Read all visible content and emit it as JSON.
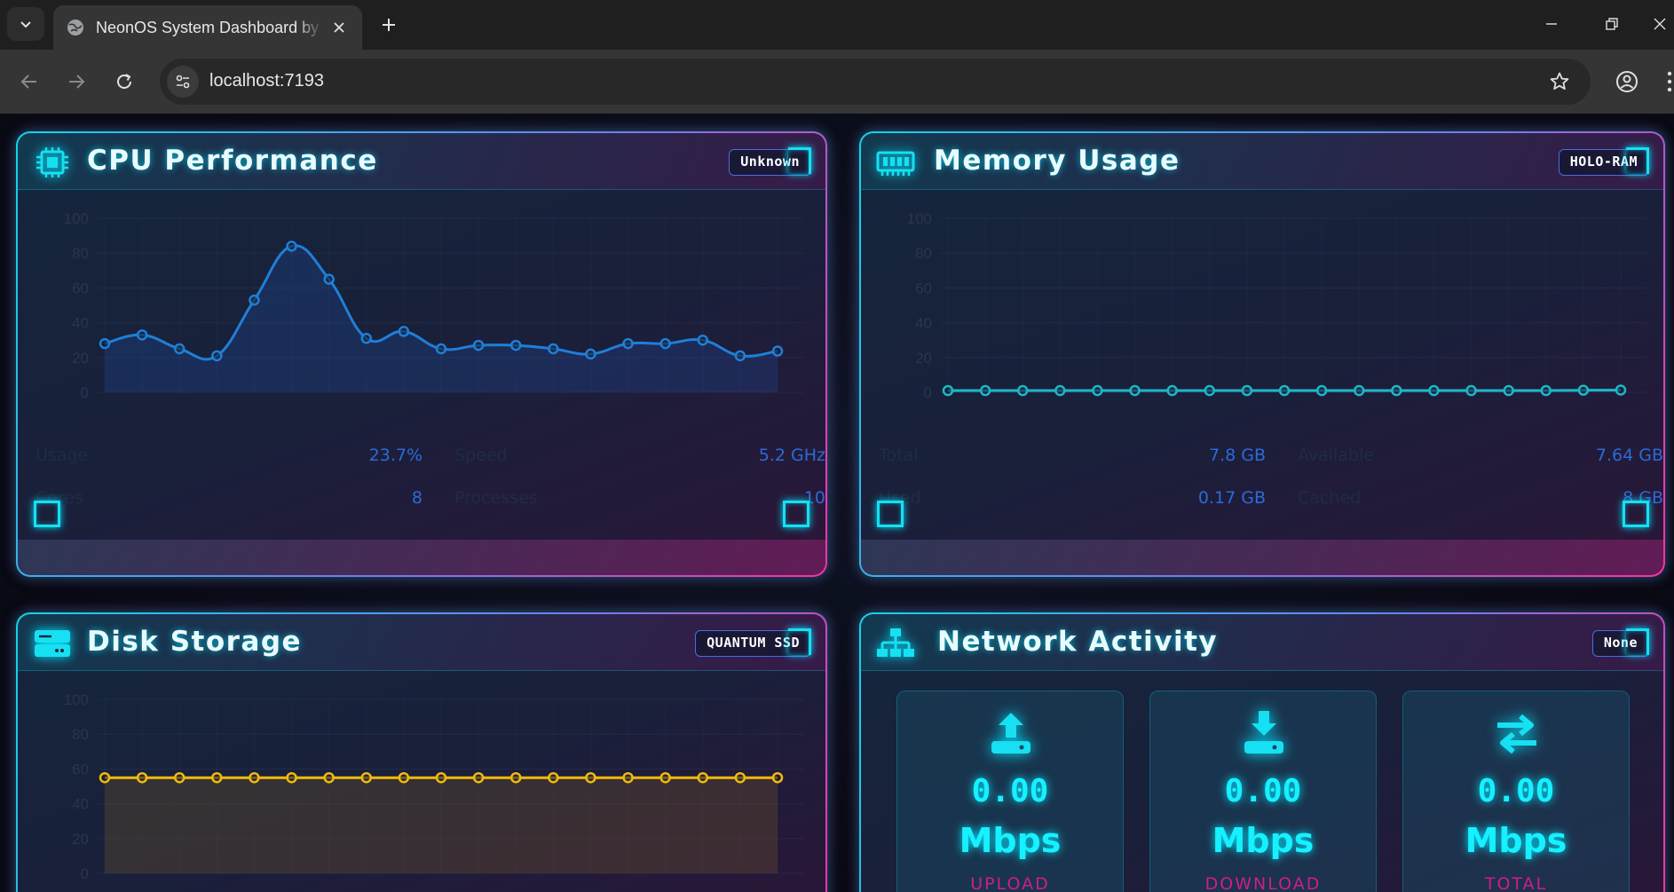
{
  "browser": {
    "tab_title": "NeonOS System Dashboard by ...",
    "url": "localhost:7193"
  },
  "colors": {
    "cyan_accent": "#16e0f2",
    "magenta_accent": "#ff2fa6",
    "cpu_line": "#1f7fd8",
    "memory_line": "#1fb6c8",
    "disk_line": "#f2b90c"
  },
  "cpu": {
    "title": "CPU Performance",
    "badge": "Unknown",
    "icon": "cpu-chip-icon",
    "stats": [
      {
        "label": "Usage",
        "value": "23.7%"
      },
      {
        "label": "Speed",
        "value": "5.2 GHz"
      },
      {
        "label": "Cores",
        "value": "8"
      },
      {
        "label": "Processes",
        "value": "10"
      }
    ]
  },
  "memory": {
    "title": "Memory Usage",
    "badge": "HOLO-RAM",
    "icon": "memory-module-icon",
    "stats": [
      {
        "label": "Total",
        "value": "7.8 GB"
      },
      {
        "label": "Available",
        "value": "7.64 GB"
      },
      {
        "label": "Used",
        "value": "0.17 GB"
      },
      {
        "label": "Cached",
        "value": "8 GB"
      }
    ]
  },
  "disk": {
    "title": "Disk Storage",
    "badge": "QUANTUM SSD",
    "icon": "hard-drive-icon"
  },
  "network": {
    "title": "Network Activity",
    "badge": "None",
    "icon": "network-topology-icon",
    "metrics": [
      {
        "value": "0.00",
        "unit": "Mbps",
        "label": "UPLOAD",
        "icon": "upload-icon"
      },
      {
        "value": "0.00",
        "unit": "Mbps",
        "label": "DOWNLOAD",
        "icon": "download-icon"
      },
      {
        "value": "0.00",
        "unit": "Mbps",
        "label": "TOTAL",
        "icon": "transfer-arrows-icon"
      }
    ]
  },
  "chart_data": [
    {
      "type": "area",
      "name": "cpu",
      "ylim": [
        0,
        100
      ],
      "yticks": [
        "100",
        "80",
        "60",
        "40",
        "20",
        "0"
      ],
      "series": [
        {
          "values": [
            28,
            33,
            25,
            21,
            53,
            84,
            65,
            31,
            35,
            25,
            27,
            27,
            25,
            22,
            28,
            28,
            30,
            21,
            23.7
          ]
        }
      ]
    },
    {
      "type": "area",
      "name": "memory",
      "ylim": [
        0,
        100
      ],
      "yticks": [
        "100",
        "80",
        "60",
        "40",
        "20",
        "0"
      ],
      "series": [
        {
          "values": [
            1,
            1,
            1,
            1,
            1,
            1,
            1,
            1,
            1,
            1,
            1,
            1,
            1,
            1,
            1,
            1,
            1,
            1.2,
            1.3
          ]
        }
      ]
    },
    {
      "type": "area",
      "name": "disk",
      "ylim": [
        0,
        100
      ],
      "yticks": [
        "100",
        "80",
        "60",
        "40",
        "20",
        "0"
      ],
      "series": [
        {
          "values": [
            55,
            55,
            55,
            55,
            55,
            55,
            55,
            55,
            55,
            55,
            55,
            55,
            55,
            55,
            55,
            55,
            55,
            55,
            55
          ]
        }
      ]
    }
  ]
}
